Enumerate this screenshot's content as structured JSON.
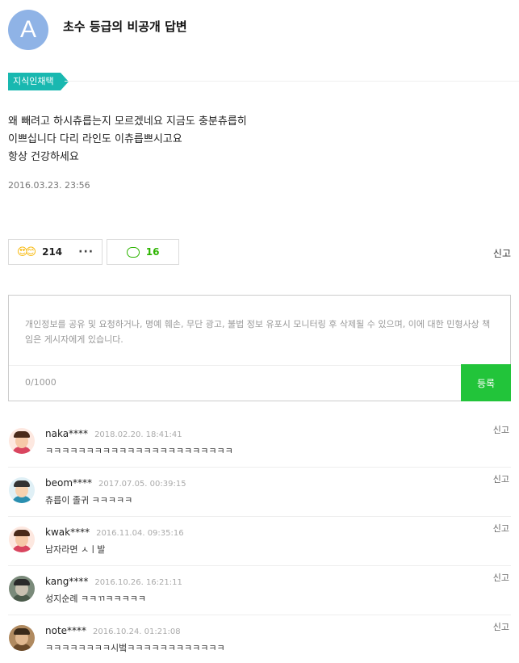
{
  "header": {
    "avatar_letter": "A",
    "title": "초수 등급의 비공개 답변"
  },
  "badge": "지식인채택",
  "answer": {
    "lines": [
      "왜 빼려고 하시츄릅는지 모르겠네요 지금도 충분츄릅히",
      "이쁘십니다 다리 라인도 이츄릅쁘시고요",
      "항상 건강하세요"
    ],
    "date": "2016.03.23. 23:56"
  },
  "reactions": {
    "emoji": "😍😊",
    "like_count": "214",
    "more": "···",
    "comment_count": "16",
    "report": "신고"
  },
  "comment_input": {
    "placeholder": "개인정보를 공유 및 요청하거나, 명예 훼손, 무단 광고, 불법 정보 유포시 모니터링 후 삭제될 수 있으며, 이에 대한 민형사상 책임은 게시자에게 있습니다.",
    "counter": "0/1000",
    "submit": "등록"
  },
  "comments": [
    {
      "user": "naka****",
      "time": "2018.02.20. 18:41:41",
      "text": "ㅋㅋㅋㅋㅋㅋㅋㅋㅋㅋㅋㅋㅋㅋㅋㅋㅋㅋㅋㅋㅋㅋㅋ",
      "report": "신고"
    },
    {
      "user": "beom****",
      "time": "2017.07.05. 00:39:15",
      "text": "츄릅이 졸귀 ㅋㅋㅋㅋㅋ",
      "report": "신고"
    },
    {
      "user": "kwak****",
      "time": "2016.11.04. 09:35:16",
      "text": "남자라면 ㅅㅣ발",
      "report": "신고"
    },
    {
      "user": "kang****",
      "time": "2016.10.26. 16:21:11",
      "text": "성지순례 ㅋㅋㄲㅋㅋㅋㅋㅋ",
      "report": "신고"
    },
    {
      "user": "note****",
      "time": "2016.10.24. 01:21:08",
      "text": "ㅋㅋㅋㅋㅋㅋㅋㅋ시벜ㅋㅋㅋㅋㅋㅋㅋㅋㅋㅋㅋㅋ",
      "report": "신고"
    }
  ],
  "colors": {
    "badge": "#19b8b0",
    "avatar": "#8fb3e6",
    "submit": "#22c43a",
    "comment_accent": "#2db400"
  }
}
